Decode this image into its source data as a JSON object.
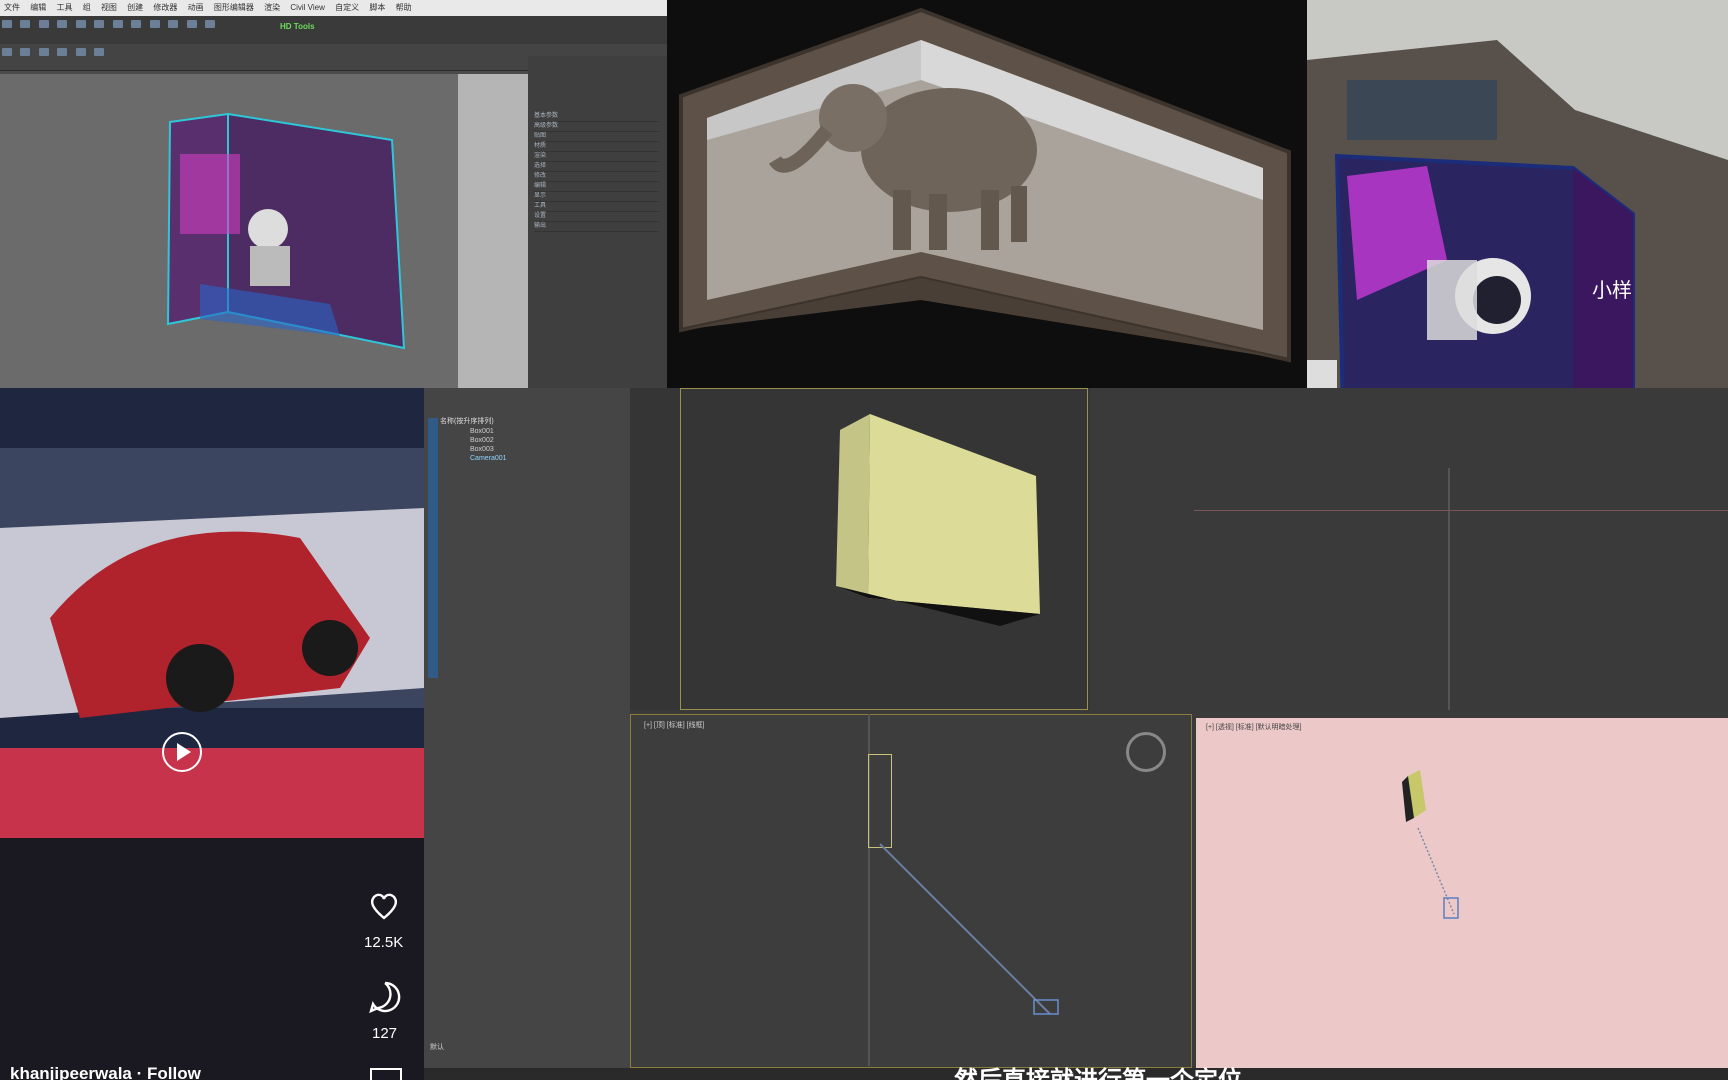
{
  "top_left_app": {
    "menu": [
      "文件",
      "编辑",
      "工具",
      "组",
      "视图",
      "创建",
      "修改器",
      "动画",
      "图形编辑器",
      "渲染",
      "Civil View",
      "自定义",
      "脚本",
      "帮助"
    ],
    "badge": "HD Tools",
    "panel_rows": [
      "基本参数",
      "高级参数",
      "贴图",
      "材质",
      "渲染",
      "选择",
      "修改",
      "编辑",
      "显示",
      "工具",
      "设置",
      "输出"
    ]
  },
  "building": {
    "sign_text": "小样"
  },
  "video": {
    "likes": "12.5K",
    "comments": "127",
    "username": "khanjipeerwala",
    "separator": "·",
    "follow": "Follow"
  },
  "max_app": {
    "scene_title": "名称(按升序排列)",
    "scene_items": [
      "Box001",
      "Box002",
      "Box003",
      "Camera001"
    ],
    "viewport_labels": {
      "bottom_left": "[+] [顶] [标准] [线框]",
      "bottom_right": "[+] [透视] [标准] [默认明暗处理]"
    },
    "status_left": "默认",
    "caption": "然后直接就进行第一个定位"
  }
}
